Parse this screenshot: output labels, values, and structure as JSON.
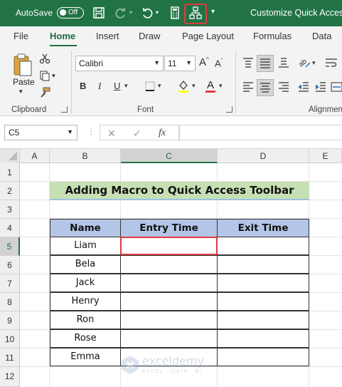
{
  "titlebar": {
    "autosave_label": "AutoSave",
    "autosave_state": "Off",
    "document_title": "Customize Quick Access",
    "icons": [
      "save-icon",
      "redo-icon",
      "undo-icon",
      "calculator-icon",
      "macro-icon",
      "customize-qat-icon"
    ]
  },
  "tabs": [
    "File",
    "Home",
    "Insert",
    "Draw",
    "Page Layout",
    "Formulas",
    "Data"
  ],
  "active_tab": "Home",
  "ribbon": {
    "clipboard": {
      "paste_label": "Paste",
      "group_label": "Clipboard"
    },
    "font": {
      "font_name": "Calibri",
      "font_size": "11",
      "group_label": "Font"
    },
    "alignment": {
      "group_label": "Alignmen"
    }
  },
  "formula_bar": {
    "name_box": "C5",
    "fx_label": "fx",
    "formula": ""
  },
  "columns": [
    "A",
    "B",
    "C",
    "D",
    "E"
  ],
  "selected_column": "C",
  "rows": [
    "1",
    "2",
    "3",
    "4",
    "5",
    "6",
    "7",
    "8",
    "9",
    "10",
    "11",
    "12"
  ],
  "selected_row": "5",
  "sheet": {
    "title": "Adding Macro to Quick Access Toolbar",
    "headers": [
      "Name",
      "Entry Time",
      "Exit Time"
    ],
    "names": [
      "Liam",
      "Bela",
      "Jack",
      "Henry",
      "Ron",
      "Rose",
      "Emma"
    ]
  },
  "watermark": {
    "name": "exceldemy",
    "tagline": "EXCEL · DATA · BI"
  },
  "colors": {
    "excel_green": "#217346",
    "highlight_red": "#e03c3c",
    "title_fill": "#c6e0b4",
    "header_fill": "#b4c6e7"
  }
}
